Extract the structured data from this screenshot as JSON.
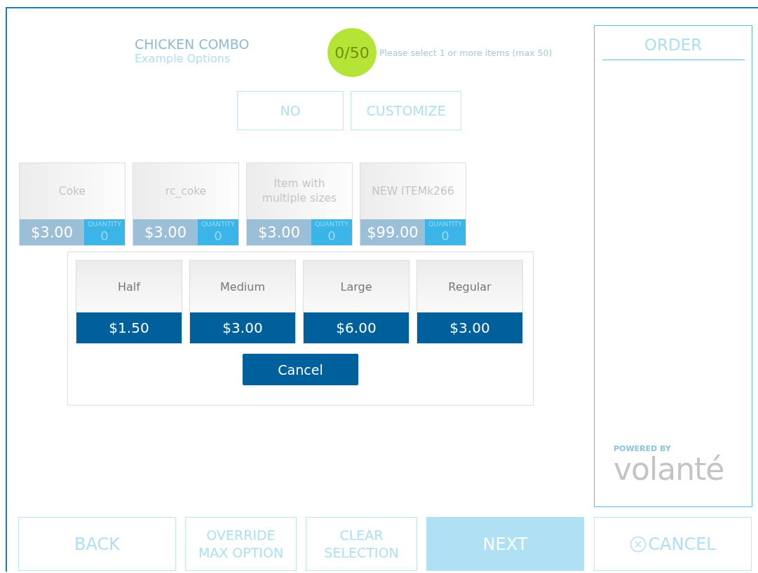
{
  "header": {
    "title": "CHICKEN COMBO",
    "subtitle": "Example Options",
    "counter": "0/50",
    "hint": "Please select 1 or more items (max 50)"
  },
  "option_buttons": [
    "NO",
    "CUSTOMIZE"
  ],
  "items": [
    {
      "name": "Coke",
      "price": "$3.00",
      "quantity_label": "QUANTITY",
      "quantity": "0"
    },
    {
      "name": "rc_coke",
      "price": "$3.00",
      "quantity_label": "QUANTITY",
      "quantity": "0"
    },
    {
      "name": "Item with multiple sizes",
      "price": "$3.00",
      "quantity_label": "QUANTITY",
      "quantity": "0"
    },
    {
      "name": "NEW ITEMk266",
      "price": "$99.00",
      "quantity_label": "QUANTITY",
      "quantity": "0"
    }
  ],
  "size_popup": {
    "sizes": [
      {
        "name": "Half",
        "price": "$1.50"
      },
      {
        "name": "Medium",
        "price": "$3.00"
      },
      {
        "name": "Large",
        "price": "$6.00"
      },
      {
        "name": "Regular",
        "price": "$3.00"
      }
    ],
    "cancel": "Cancel"
  },
  "order": {
    "title": "ORDER",
    "powered_by": "POWERED BY",
    "brand": "volanté"
  },
  "bottom_buttons": [
    {
      "label": "BACK",
      "kind": "outline"
    },
    {
      "label": "OVERRIDE MAX OPTION",
      "kind": "outline"
    },
    {
      "label": "CLEAR SELECTION",
      "kind": "outline"
    },
    {
      "label": "NEXT",
      "kind": "primary"
    },
    {
      "label": "CANCEL",
      "kind": "cancel"
    }
  ]
}
